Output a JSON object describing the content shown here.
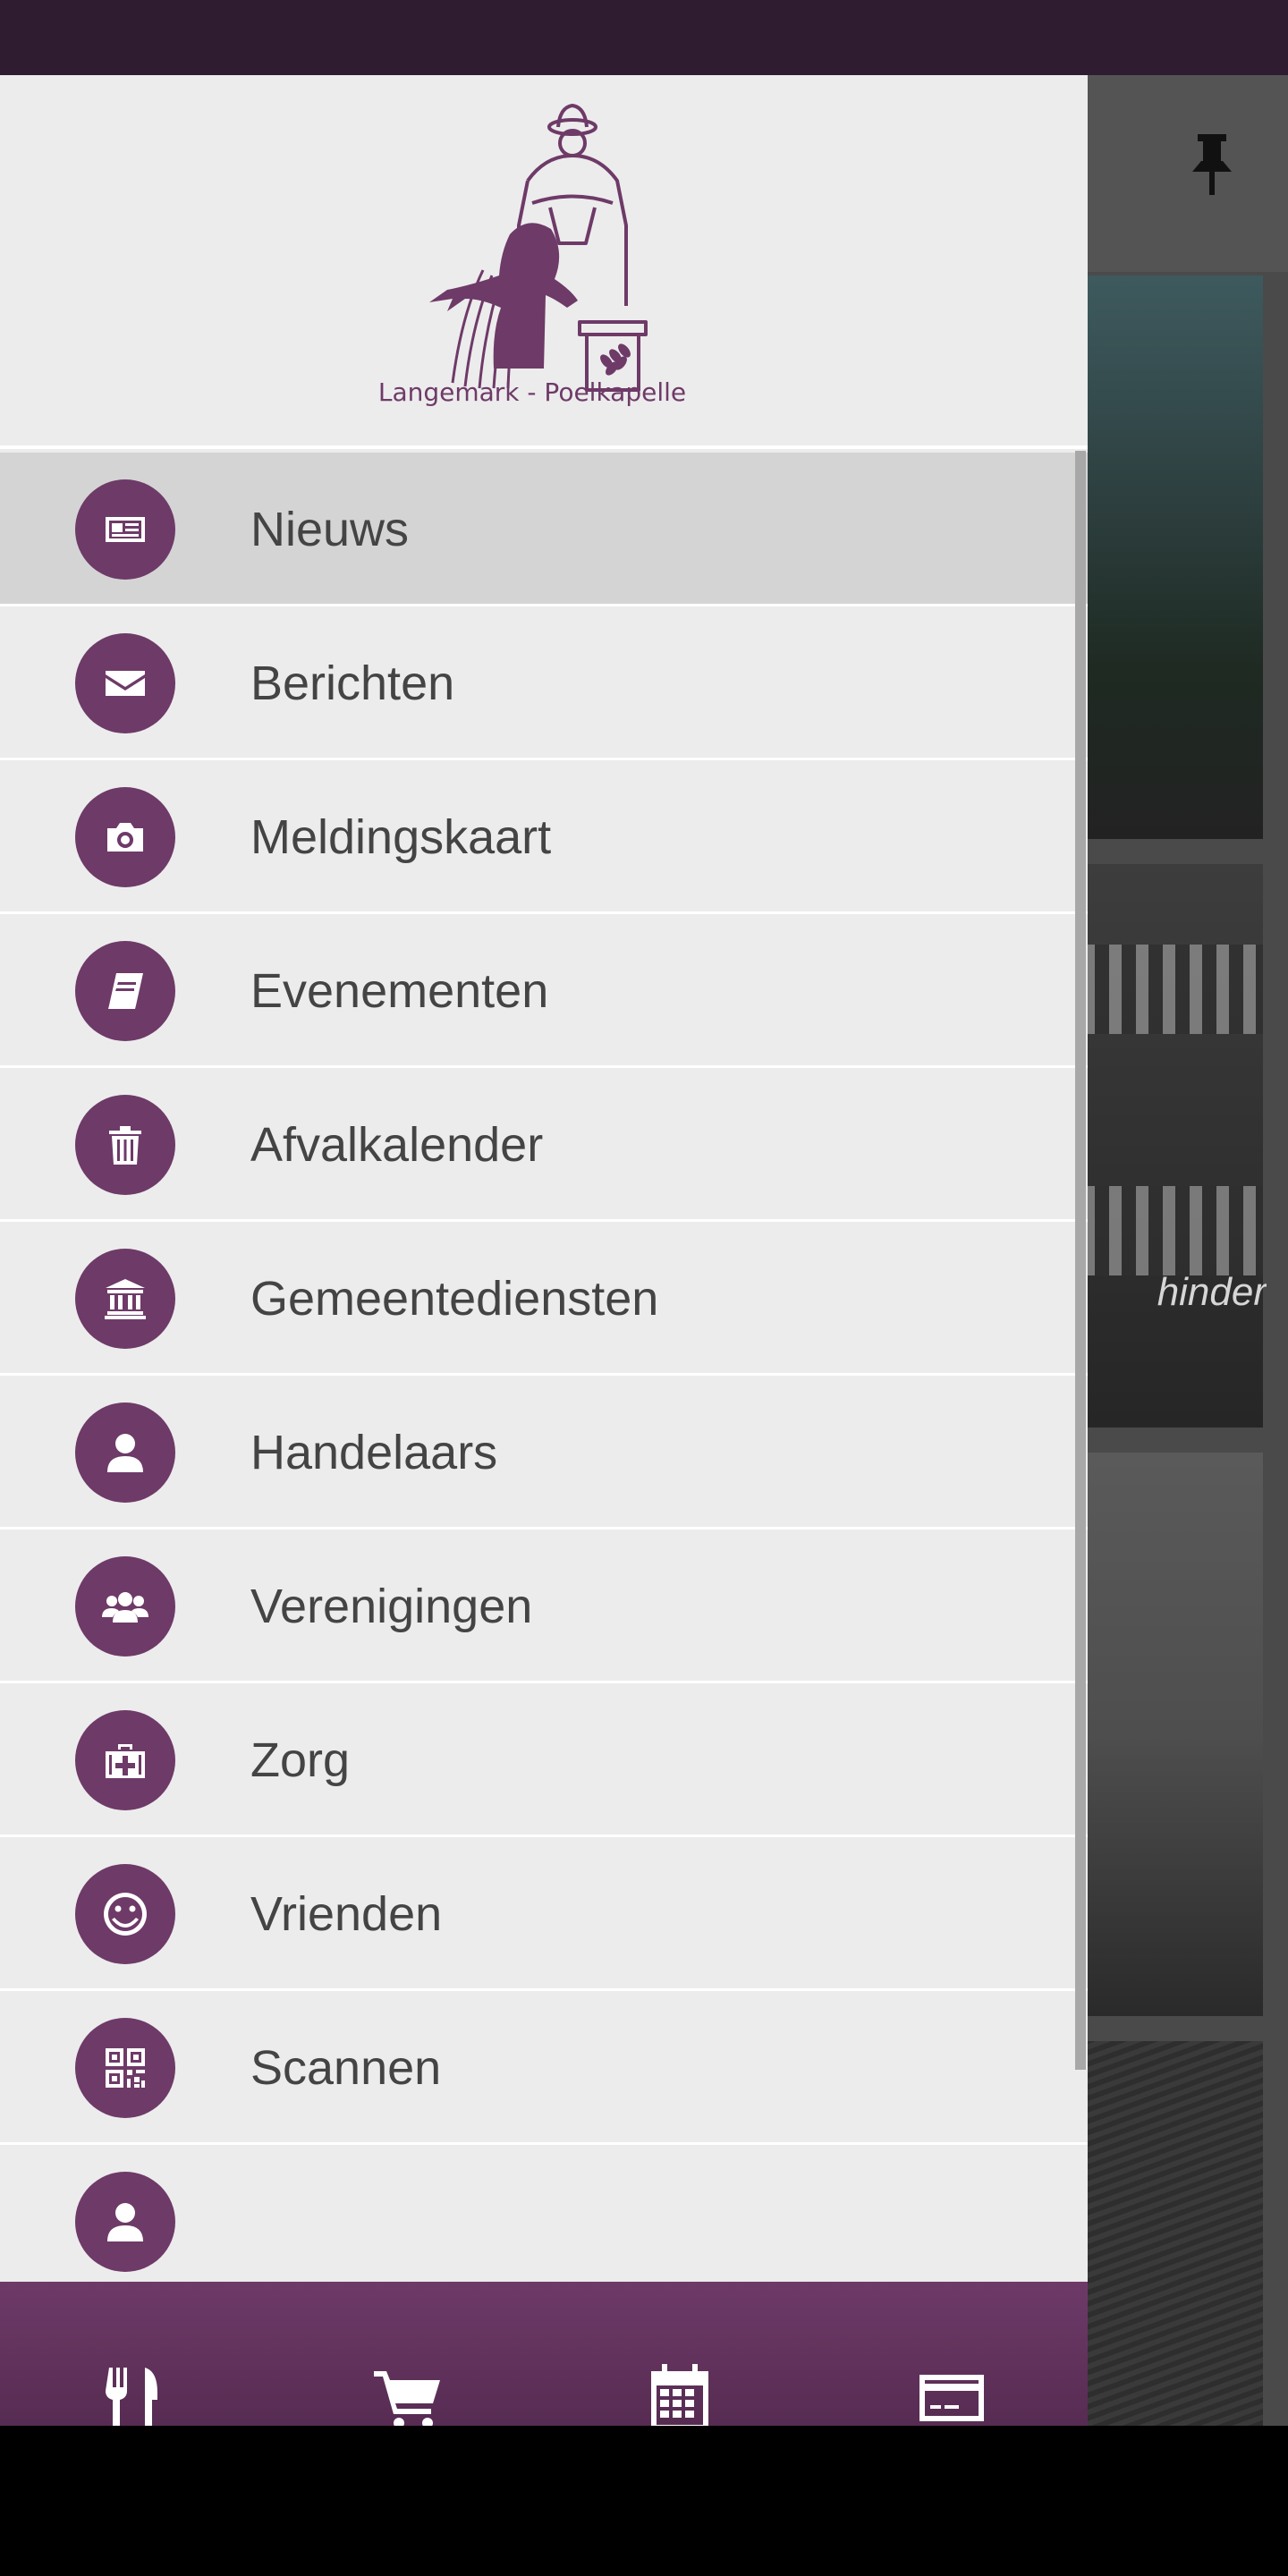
{
  "logo": {
    "text": "Langemark - Poelkapelle"
  },
  "menu": {
    "items": [
      {
        "label": "Nieuws",
        "icon": "newspaper-icon"
      },
      {
        "label": "Berichten",
        "icon": "envelope-icon"
      },
      {
        "label": "Meldingskaart",
        "icon": "camera-icon"
      },
      {
        "label": "Evenementen",
        "icon": "book-icon"
      },
      {
        "label": "Afvalkalender",
        "icon": "trash-icon"
      },
      {
        "label": "Gemeentediensten",
        "icon": "institution-icon"
      },
      {
        "label": "Handelaars",
        "icon": "user-icon"
      },
      {
        "label": "Verenigingen",
        "icon": "users-icon"
      },
      {
        "label": "Zorg",
        "icon": "medkit-icon"
      },
      {
        "label": "Vrienden",
        "icon": "smile-icon"
      },
      {
        "label": "Scannen",
        "icon": "qrcode-icon"
      }
    ]
  },
  "background": {
    "card_caption": "hinder"
  },
  "bottom_bar": {
    "icons": [
      "cutlery-icon",
      "cart-icon",
      "calendar-icon",
      "credit-card-icon"
    ]
  },
  "colors": {
    "accent": "#6e3a68",
    "status_bar": "#301c30",
    "drawer_bg": "#ececec",
    "active_row": "#d4d4d4"
  }
}
